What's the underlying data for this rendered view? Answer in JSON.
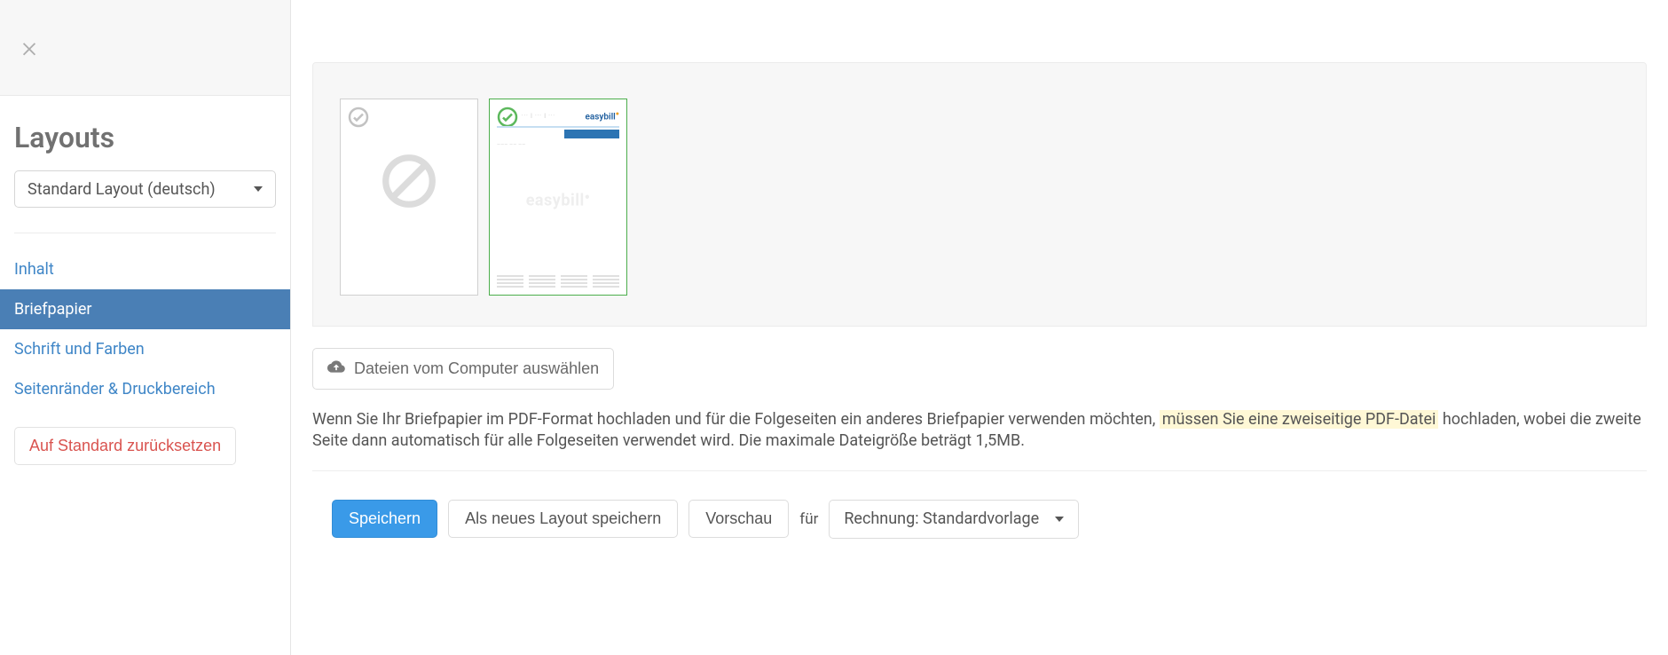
{
  "sidebar": {
    "title": "Layouts",
    "select_label": "Standard Layout (deutsch)",
    "nav": [
      {
        "label": "Inhalt"
      },
      {
        "label": "Briefpapier"
      },
      {
        "label": "Schrift und Farben"
      },
      {
        "label": "Seitenränder & Druckbereich"
      }
    ],
    "reset_label": "Auf Standard zurücksetzen"
  },
  "main": {
    "thumb_brand": "easybill",
    "watermark": "easybill",
    "upload_label": "Dateien vom Computer auswählen",
    "info_pre": "Wenn Sie Ihr Briefpapier im PDF-Format hochladen und für die Folgeseiten ein anderes Briefpapier verwenden möchten, ",
    "info_mark": "müssen Sie eine zweiseitige PDF-Datei",
    "info_post": " hochladen, wobei die zweite Seite dann automatisch für alle Folgeseiten verwendet wird. Die maximale Dateigröße beträgt 1,5MB.",
    "actions": {
      "save": "Speichern",
      "save_as": "Als neues Layout speichern",
      "preview": "Vorschau",
      "for": "für",
      "preview_select": "Rechnung: Standardvorlage"
    }
  }
}
